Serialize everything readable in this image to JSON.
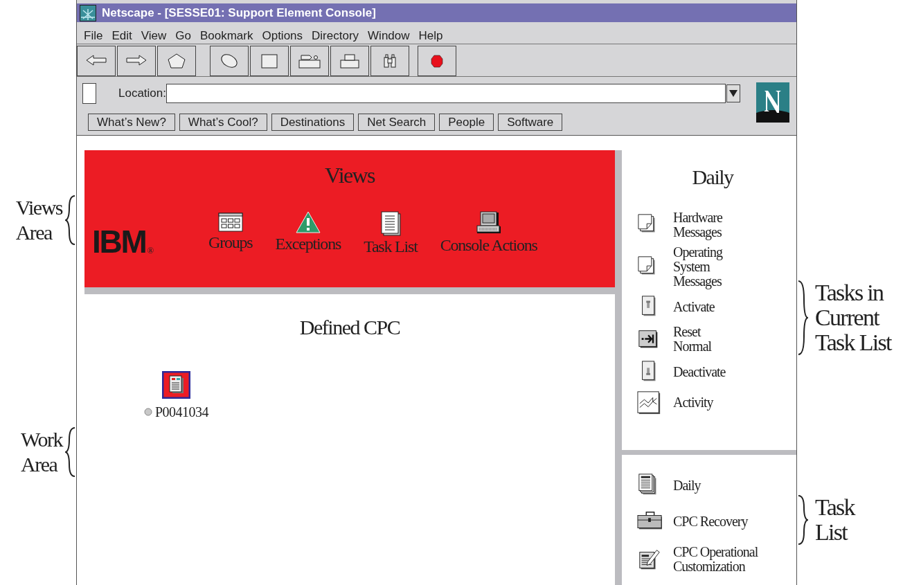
{
  "window": {
    "title": "Netscape - [SESSE01: Support Element Console]"
  },
  "menu": [
    "File",
    "Edit",
    "View",
    "Go",
    "Bookmark",
    "Options",
    "Directory",
    "Window",
    "Help"
  ],
  "toolbar": [
    {
      "kind": "back"
    },
    {
      "kind": "forward"
    },
    {
      "kind": "home"
    },
    {
      "kind": "reload"
    },
    {
      "kind": "images"
    },
    {
      "kind": "open"
    },
    {
      "kind": "print"
    },
    {
      "kind": "find"
    },
    {
      "kind": "stop"
    }
  ],
  "location": {
    "label": "Location:"
  },
  "directory_buttons": [
    "What’s New?",
    "What’s Cool?",
    "Destinations",
    "Net Search",
    "People",
    "Software"
  ],
  "views": {
    "title": "Views",
    "logo": "IBM",
    "registered": "®",
    "items": [
      {
        "label": "Groups",
        "kind": "groups"
      },
      {
        "label": "Exceptions",
        "kind": "exceptions"
      },
      {
        "label": "Task List",
        "kind": "tasklist"
      },
      {
        "label": "Console Actions",
        "kind": "console"
      }
    ]
  },
  "work_area": {
    "title": "Defined CPC",
    "objects": [
      {
        "label": "P0041034",
        "selected": true
      }
    ]
  },
  "tasks": {
    "title": "Daily",
    "items": [
      {
        "label": "Hardware\nMessages",
        "kind": "messages"
      },
      {
        "label": "Operating\nSystem\nMessages",
        "kind": "messages"
      },
      {
        "label": "Activate",
        "kind": "switch_up"
      },
      {
        "label": "Reset\nNormal",
        "kind": "reset"
      },
      {
        "label": "Deactivate",
        "kind": "switch_down"
      },
      {
        "label": "Activity",
        "kind": "activity"
      }
    ]
  },
  "task_list": {
    "items": [
      {
        "label": "Daily",
        "kind": "stack"
      },
      {
        "label": "CPC Recovery",
        "kind": "toolbox"
      },
      {
        "label": "CPC Operational\nCustomization",
        "kind": "edit"
      }
    ]
  },
  "left_callouts": [
    {
      "lines": [
        "Views",
        "Area"
      ]
    },
    {
      "lines": [
        "Work",
        "Area"
      ]
    }
  ],
  "right_callouts": [
    {
      "lines": [
        "Tasks in",
        "Current",
        "Task List"
      ]
    },
    {
      "lines": [
        "Task",
        "List"
      ]
    }
  ]
}
